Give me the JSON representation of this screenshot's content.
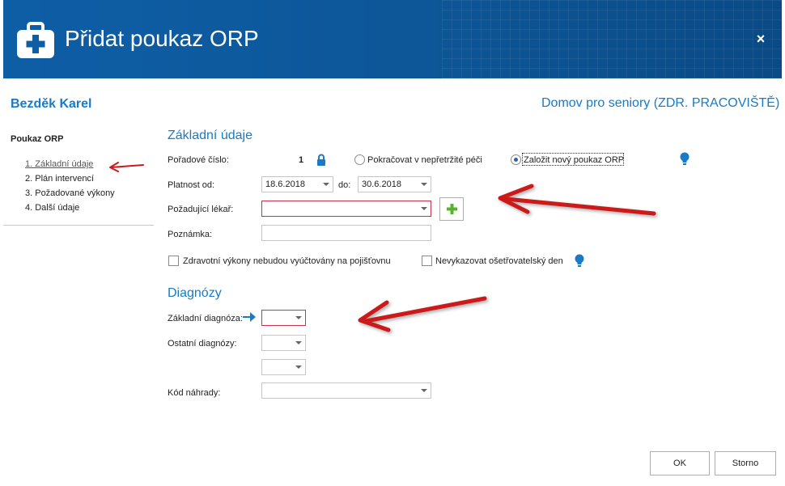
{
  "dialog": {
    "title": "Přidat poukaz ORP",
    "close_glyph": "×"
  },
  "patient": {
    "name": "Bezděk Karel",
    "workplace": "Domov pro seniory (ZDR. PRACOVIŠTĚ)"
  },
  "sidebar": {
    "title": "Poukaz ORP",
    "items": [
      {
        "label": "1. Základní údaje",
        "active": true
      },
      {
        "label": "2. Plán intervencí"
      },
      {
        "label": "3. Požadované výkony"
      },
      {
        "label": "4. Další údaje"
      }
    ]
  },
  "basic": {
    "title": "Základní údaje",
    "order_label": "Pořadové číslo:",
    "order_value": "1",
    "radio_continue": "Pokračovat v nepřetržité péči",
    "radio_new": "Založit nový poukaz ORP",
    "validity_label": "Platnost od:",
    "validity_from": "18.6.2018",
    "validity_to_label": "do:",
    "validity_to": "30.6.2018",
    "doctor_label": "Požadující lékař:",
    "doctor_value": "",
    "note_label": "Poznámka:",
    "note_value": "",
    "check_not_billed": "Zdravotní výkony nebudou vyúčtovány na pojišťovnu",
    "check_no_nursing_day": "Nevykazovat ošetřovatelský den"
  },
  "diagnoses": {
    "title": "Diagnózy",
    "main_label": "Základní diagnóza:",
    "other_label": "Ostatní diagnózy:",
    "replacement_label": "Kód náhrady:"
  },
  "footer": {
    "ok_label": "OK",
    "cancel_label": "Storno"
  },
  "icons": {
    "lock": "lock-icon",
    "hint": "lightbulb-icon",
    "arrow": "arrow-right-icon",
    "add": "plus-icon",
    "logo": "medical-kit-icon"
  },
  "colors": {
    "header": "#0e5ea6",
    "accent": "#1a7ac4",
    "error_border": "#c8324a",
    "annotation": "#cc1a1a",
    "plus": "#5bb030"
  }
}
